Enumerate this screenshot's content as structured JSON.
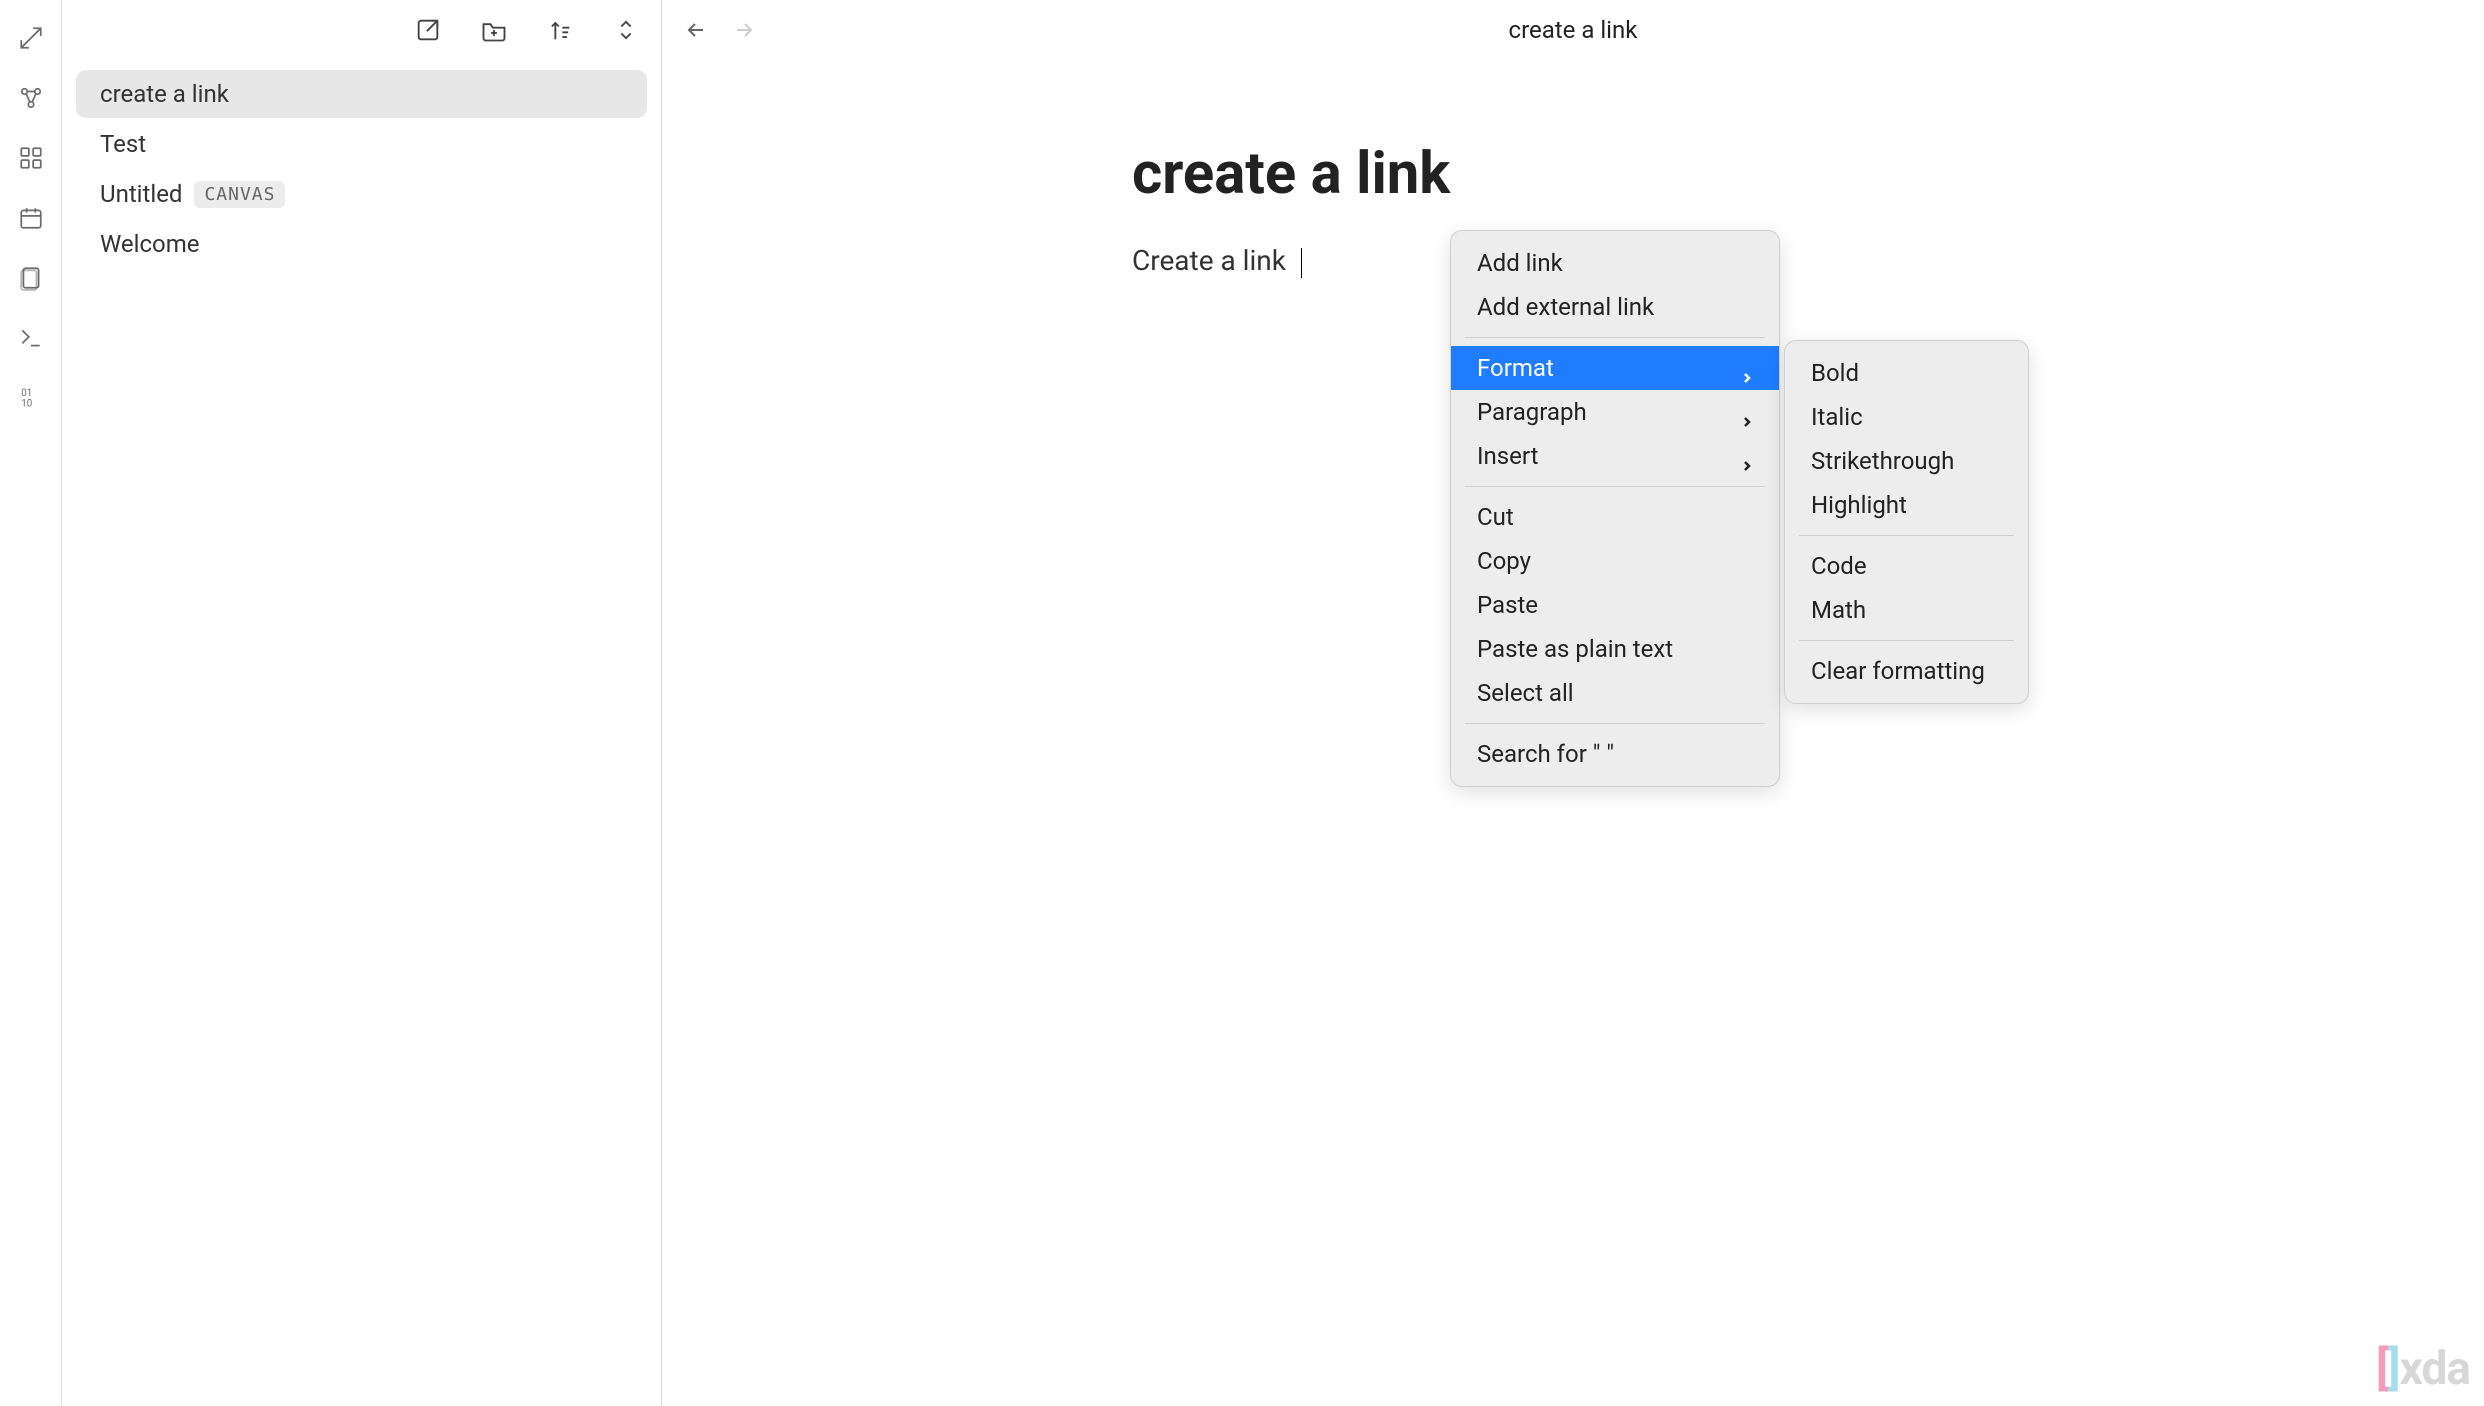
{
  "sidebar": {
    "files": [
      {
        "name": "create a link",
        "active": true,
        "badge": null
      },
      {
        "name": "Test",
        "active": false,
        "badge": null
      },
      {
        "name": "Untitled",
        "active": false,
        "badge": "CANVAS"
      },
      {
        "name": "Welcome",
        "active": false,
        "badge": null
      }
    ]
  },
  "header": {
    "title": "create a link"
  },
  "document": {
    "title": "create a link",
    "body": "Create a link"
  },
  "context_menu": {
    "items": [
      {
        "label": "Add link",
        "submenu": false
      },
      {
        "label": "Add external link",
        "submenu": false
      },
      {
        "sep": true
      },
      {
        "label": "Format",
        "submenu": true,
        "highlighted": true
      },
      {
        "label": "Paragraph",
        "submenu": true
      },
      {
        "label": "Insert",
        "submenu": true
      },
      {
        "sep": true
      },
      {
        "label": "Cut",
        "submenu": false
      },
      {
        "label": "Copy",
        "submenu": false
      },
      {
        "label": "Paste",
        "submenu": false
      },
      {
        "label": "Paste as plain text",
        "submenu": false
      },
      {
        "label": "Select all",
        "submenu": false
      },
      {
        "sep": true
      },
      {
        "label": "Search for \" \"",
        "submenu": false
      }
    ]
  },
  "format_submenu": {
    "items": [
      {
        "label": "Bold"
      },
      {
        "label": "Italic"
      },
      {
        "label": "Strikethrough"
      },
      {
        "label": "Highlight"
      },
      {
        "sep": true
      },
      {
        "label": "Code"
      },
      {
        "label": "Math"
      },
      {
        "sep": true
      },
      {
        "label": "Clear formatting"
      }
    ]
  },
  "watermark": {
    "brand": "xda"
  }
}
